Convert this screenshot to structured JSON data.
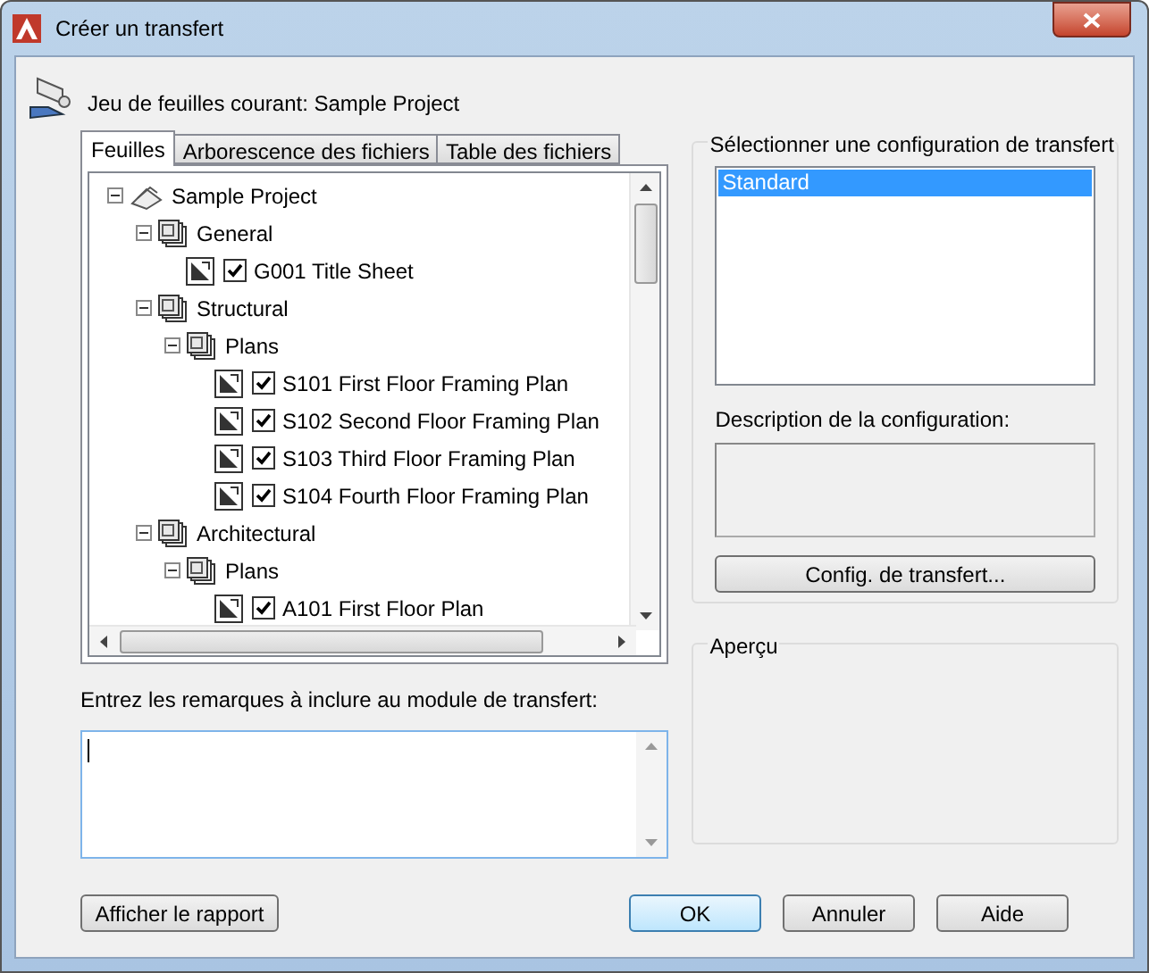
{
  "window": {
    "title": "Créer un transfert"
  },
  "current_set": {
    "label": "Jeu de feuilles courant: Sample Project"
  },
  "tabs": [
    {
      "label": "Feuilles",
      "selected": true
    },
    {
      "label": "Arborescence des fichiers",
      "selected": false
    },
    {
      "label": "Table des fichiers",
      "selected": false
    }
  ],
  "tree": [
    {
      "label": "Sample Project",
      "kind": "project",
      "expanded": true,
      "children": [
        {
          "label": "General",
          "kind": "group",
          "expanded": true,
          "children": [
            {
              "label": "G001 Title Sheet",
              "kind": "sheet",
              "checked": true
            }
          ]
        },
        {
          "label": "Structural",
          "kind": "group",
          "expanded": true,
          "children": [
            {
              "label": "Plans",
              "kind": "group",
              "expanded": true,
              "children": [
                {
                  "label": "S101 First Floor Framing Plan",
                  "kind": "sheet",
                  "checked": true
                },
                {
                  "label": "S102 Second Floor Framing Plan",
                  "kind": "sheet",
                  "checked": true
                },
                {
                  "label": "S103 Third Floor Framing Plan",
                  "kind": "sheet",
                  "checked": true
                },
                {
                  "label": "S104 Fourth Floor Framing Plan",
                  "kind": "sheet",
                  "checked": true
                }
              ]
            }
          ]
        },
        {
          "label": "Architectural",
          "kind": "group",
          "expanded": true,
          "children": [
            {
              "label": "Plans",
              "kind": "group",
              "expanded": true,
              "children": [
                {
                  "label": "A101 First Floor Plan",
                  "kind": "sheet",
                  "checked": true
                }
              ]
            }
          ]
        }
      ]
    }
  ],
  "notes": {
    "label": "Entrez les remarques à inclure au module de transfert:"
  },
  "config": {
    "title": "Sélectionner une configuration de transfert",
    "items": [
      {
        "label": "Standard",
        "selected": true
      }
    ],
    "description_label": "Description de la configuration:",
    "button": "Config. de transfert..."
  },
  "preview": {
    "title": "Aperçu"
  },
  "buttons": {
    "report": "Afficher le rapport",
    "ok": "OK",
    "cancel": "Annuler",
    "help": "Aide"
  }
}
